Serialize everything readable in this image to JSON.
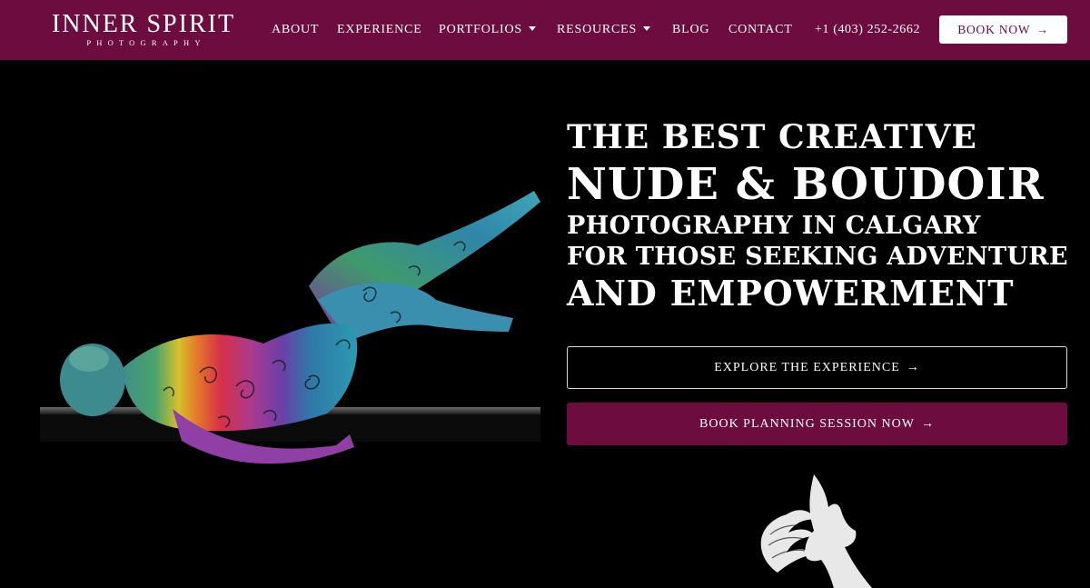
{
  "brand": {
    "name": "INNER SPIRIT",
    "tagline": "PHOTOGRAPHY"
  },
  "nav": {
    "items": [
      {
        "label": "ABOUT",
        "dropdown": false
      },
      {
        "label": "EXPERIENCE",
        "dropdown": false
      },
      {
        "label": "PORTFOLIOS",
        "dropdown": true
      },
      {
        "label": "RESOURCES",
        "dropdown": true
      },
      {
        "label": "BLOG",
        "dropdown": false
      },
      {
        "label": "CONTACT",
        "dropdown": false
      }
    ],
    "phone": "+1 (403) 252-2662",
    "book_now": "BOOK NOW",
    "arrow": "→"
  },
  "hero": {
    "line1": "THE BEST CREATIVE",
    "line2": "NUDE & BOUDOIR",
    "line3": "PHOTOGRAPHY IN CALGARY",
    "line4": "FOR THOSE SEEKING ADVENTURE",
    "line5": "AND EMPOWERMENT",
    "cta_primary": "EXPLORE THE EXPERIENCE",
    "cta_secondary": "BOOK PLANNING SESSION NOW",
    "arrow": "→"
  },
  "colors": {
    "brand": "#6d0c3f",
    "background": "#000000",
    "text": "#ffffff",
    "button_bg": "#ffffff"
  },
  "icons": {
    "emblem": "woman-silhouette-emblem",
    "dropdown": "caret-down-icon",
    "arrow": "arrow-right-icon"
  }
}
